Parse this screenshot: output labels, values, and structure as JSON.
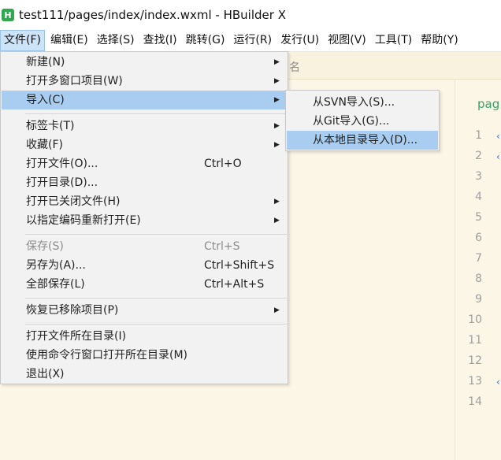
{
  "window": {
    "title": "test111/pages/index/index.wxml - HBuilder X",
    "logo_text": "H"
  },
  "menubar": {
    "items": [
      {
        "label": "文件(F)"
      },
      {
        "label": "编辑(E)"
      },
      {
        "label": "选择(S)"
      },
      {
        "label": "查找(I)"
      },
      {
        "label": "跳转(G)"
      },
      {
        "label": "运行(R)"
      },
      {
        "label": "发行(U)"
      },
      {
        "label": "视图(V)"
      },
      {
        "label": "工具(T)"
      },
      {
        "label": "帮助(Y)"
      }
    ]
  },
  "editor": {
    "tab_partial": "名",
    "breadcrumb_partial": "pag",
    "line_numbers": [
      "1",
      "2",
      "3",
      "4",
      "5",
      "6",
      "7",
      "8",
      "9",
      "10",
      "11",
      "12",
      "13",
      "14"
    ]
  },
  "file_menu": {
    "items": [
      {
        "label": "新建(N)",
        "shortcut": "",
        "submenu": true
      },
      {
        "label": "打开多窗口项目(W)",
        "shortcut": "",
        "submenu": true
      },
      {
        "label": "导入(C)",
        "shortcut": "",
        "submenu": true
      },
      {
        "label": "标签卡(T)",
        "shortcut": "",
        "submenu": true
      },
      {
        "label": "收藏(F)",
        "shortcut": "",
        "submenu": true
      },
      {
        "label": "打开文件(O)...",
        "shortcut": "Ctrl+O",
        "submenu": false
      },
      {
        "label": "打开目录(D)...",
        "shortcut": "",
        "submenu": false
      },
      {
        "label": "打开已关闭文件(H)",
        "shortcut": "",
        "submenu": true
      },
      {
        "label": "以指定编码重新打开(E)",
        "shortcut": "",
        "submenu": true
      },
      {
        "label": "保存(S)",
        "shortcut": "Ctrl+S",
        "submenu": false
      },
      {
        "label": "另存为(A)...",
        "shortcut": "Ctrl+Shift+S",
        "submenu": false
      },
      {
        "label": "全部保存(L)",
        "shortcut": "Ctrl+Alt+S",
        "submenu": false
      },
      {
        "label": "恢复已移除项目(P)",
        "shortcut": "",
        "submenu": true
      },
      {
        "label": "打开文件所在目录(I)",
        "shortcut": "",
        "submenu": false
      },
      {
        "label": "使用命令行窗口打开所在目录(M)",
        "shortcut": "",
        "submenu": false
      },
      {
        "label": "退出(X)",
        "shortcut": "",
        "submenu": false
      }
    ]
  },
  "import_submenu": {
    "items": [
      {
        "label": "从SVN导入(S)..."
      },
      {
        "label": "从Git导入(G)..."
      },
      {
        "label": "从本地目录导入(D)..."
      }
    ]
  },
  "colors": {
    "editor_bg": "#fbf6e6",
    "menu_bg": "#f2f2f2",
    "highlight": "#a8cdf0",
    "logo": "#2fa84f"
  },
  "icons": {
    "logo": "hbuilder-logo-icon",
    "submenu_arrow": "submenu-arrow-icon",
    "fold": "fold-marker-icon"
  }
}
